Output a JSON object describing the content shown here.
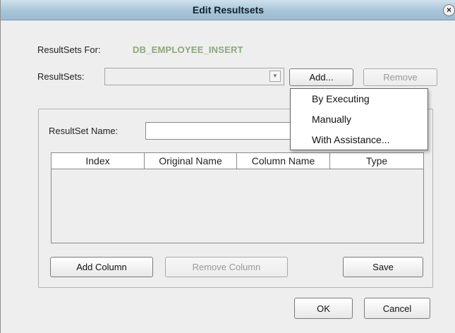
{
  "dialog": {
    "title": "Edit Resultsets",
    "close_glyph": "×"
  },
  "resultsets_for": {
    "label": "ResultSets For:",
    "value": "DB_EMPLOYEE_INSERT"
  },
  "resultsets": {
    "label": "ResultSets:",
    "selected": "",
    "add_label": "Add...",
    "remove_label": "Remove"
  },
  "add_menu": {
    "items": [
      "By Executing",
      "Manually",
      "With Assistance..."
    ]
  },
  "resultset_name": {
    "label": "ResultSet Name:",
    "value": ""
  },
  "columns_table": {
    "headers": [
      "Index",
      "Original Name",
      "Column Name",
      "Type"
    ]
  },
  "group_buttons": {
    "add_column": "Add Column",
    "remove_column": "Remove Column",
    "save": "Save"
  },
  "footer": {
    "ok": "OK",
    "cancel": "Cancel"
  },
  "colors": {
    "title_bar": "#a8c4d8",
    "dialog_background": "#eeeeee",
    "green_value": "#8ba77c"
  },
  "icons": {
    "close": "close-icon",
    "combo": "chevron-down-icon"
  }
}
